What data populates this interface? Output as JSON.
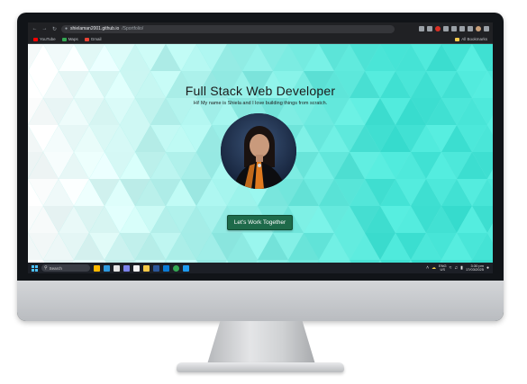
{
  "browser": {
    "url_domain": "shielaman2001.github.io",
    "url_path": "/Sportfolio/",
    "nav": {
      "back": "←",
      "forward": "→",
      "reload": "↻"
    },
    "bookmarks": [
      {
        "label": "YouTube",
        "color": "#ff0000"
      },
      {
        "label": "Maps",
        "color": "#34a853"
      },
      {
        "label": "Gmail",
        "color": "#ea4335"
      }
    ],
    "all_bookmarks_label": "All Bookmarks"
  },
  "page": {
    "title": "Full Stack Web Developer",
    "subtitle": "Hi! My name is Shiela and I love building things from scratch.",
    "cta_label": "Let's Work Together",
    "accent_color": "#1e6a4a",
    "background_color": "#7fe9e0"
  },
  "taskbar": {
    "search_label": "Search",
    "language_top": "ENG",
    "language_bottom": "US",
    "time": "3:30 pm",
    "date": "17/03/2025",
    "app_icons": [
      "explorer-icon",
      "edge-icon",
      "store-icon",
      "chat-icon",
      "calendar-icon",
      "files-icon",
      "word-icon",
      "vscode-icon",
      "chrome-icon",
      "photos-icon"
    ]
  }
}
